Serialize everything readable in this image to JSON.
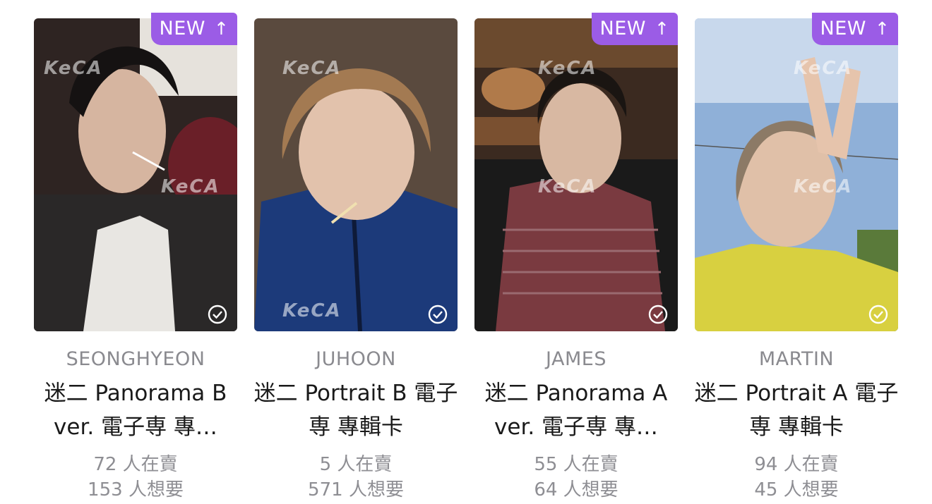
{
  "cards": [
    {
      "badge": "NEW",
      "badge_icon": "arrow-up-icon",
      "member": "SEONGHYEON",
      "title": "迷二 Panorama B ver. 電子専 專…",
      "sell": "72 人在賣",
      "want": "153 人想要",
      "colors": {
        "bg": "#2e2422",
        "top": "#e6e2dc",
        "shirt": "#2a2828"
      }
    },
    {
      "badge": "",
      "badge_icon": "",
      "member": "JUHOON",
      "title": "迷二 Portrait B 電子専 專輯卡",
      "sell": "5 人在賣",
      "want": "571 人想要",
      "colors": {
        "bg": "#5a4a3e",
        "top": "#b89a78",
        "shirt": "#1c3a7a"
      }
    },
    {
      "badge": "NEW",
      "badge_icon": "arrow-up-icon",
      "member": "JAMES",
      "title": "迷二 Panorama A ver. 電子専 專…",
      "sell": "55 人在賣",
      "want": "64 人想要",
      "colors": {
        "bg": "#3b2a20",
        "top": "#6b4a2e",
        "shirt": "#7a3a40"
      }
    },
    {
      "badge": "NEW",
      "badge_icon": "arrow-up-icon",
      "member": "MARTIN",
      "title": "迷二 Portrait A 電子専 專輯卡",
      "sell": "94 人在賣",
      "want": "45 人想要",
      "colors": {
        "bg": "#8fb0d8",
        "top": "#c8d8ec",
        "shirt": "#d8d040"
      }
    }
  ],
  "watermark": "KeCA",
  "accent": "#9b5ce6"
}
